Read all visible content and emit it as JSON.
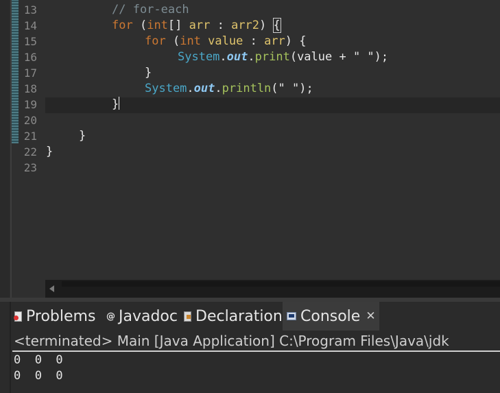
{
  "editor": {
    "line_numbers": [
      "13",
      "14",
      "15",
      "16",
      "17",
      "18",
      "19",
      "20",
      "21",
      "22",
      "23"
    ],
    "code": {
      "l13_comment": "// for-each",
      "l14_for": "for",
      "l14_open": " (",
      "l14_type": "int",
      "l14_arr": "[] ",
      "l14_var": "arr",
      "l14_colon": " : ",
      "l14_src": "arr2",
      "l14_close": ") ",
      "l14_brace": "{",
      "l15_for": "for",
      "l15_open": " (",
      "l15_type": "int",
      "l15_var": " value",
      "l15_colon": " : ",
      "l15_src": "arr",
      "l15_close": ") {",
      "l16_class": "System",
      "l16_dot1": ".",
      "l16_field": "out",
      "l16_dot2": ".",
      "l16_method": "print",
      "l16_args": "(value + ",
      "l16_str": "\" \"",
      "l16_end": ");",
      "l17_brace": "}",
      "l18_class": "System",
      "l18_dot1": ".",
      "l18_field": "out",
      "l18_dot2": ".",
      "l18_method": "println",
      "l18_open": "(",
      "l18_str": "\" \"",
      "l18_end": ");",
      "l19_brace": "}",
      "l21_brace": "}",
      "l22_brace": "}"
    }
  },
  "panel": {
    "tabs": [
      {
        "label": "Problems",
        "icon": "problems-icon"
      },
      {
        "label": "Javadoc",
        "icon": "javadoc-icon"
      },
      {
        "label": "Declaration",
        "icon": "declaration-icon"
      },
      {
        "label": "Console",
        "icon": "console-icon",
        "active": true
      }
    ],
    "console_header": "<terminated> Main [Java Application] C:\\Program Files\\Java\\jdk",
    "console_lines": [
      "0  0  0",
      "0  0  0"
    ]
  },
  "colors": {
    "keyword": "#cc7832",
    "variable": "#e0c46c",
    "class": "#4aa7c8",
    "method": "#a5c25c",
    "comment": "#7d8c93",
    "background": "#2f2f2f"
  }
}
